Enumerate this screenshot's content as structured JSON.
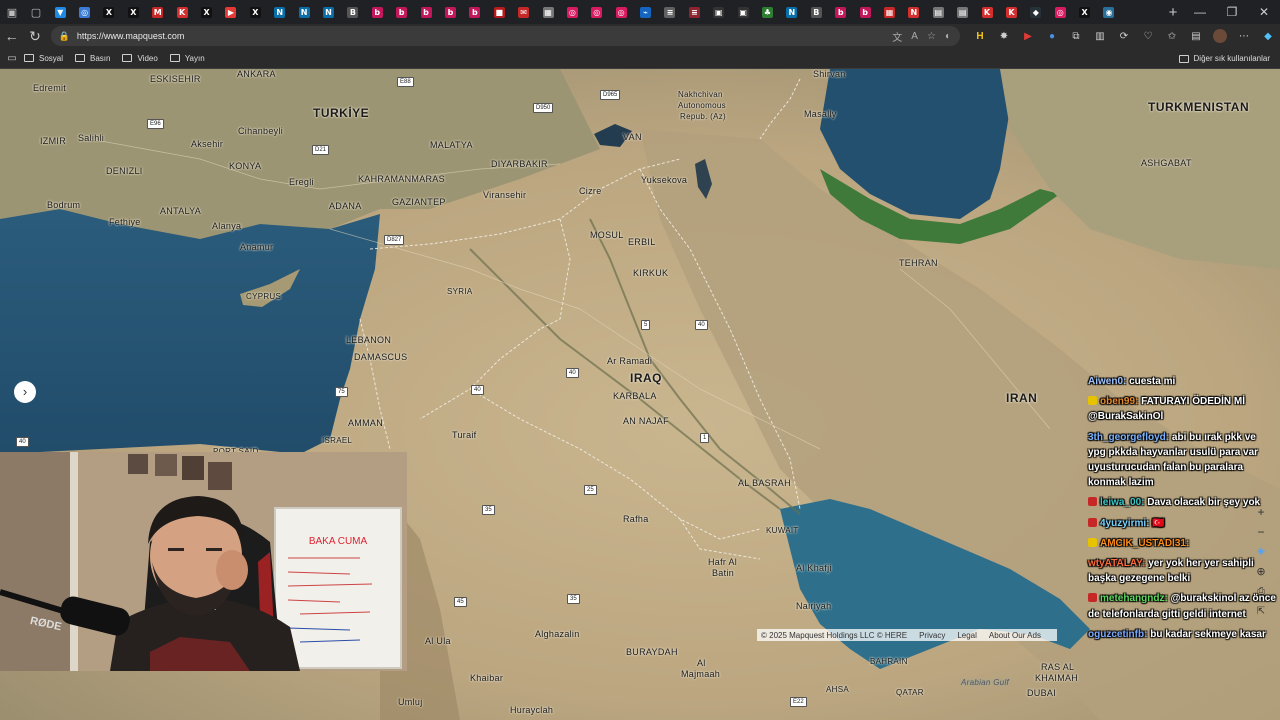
{
  "browser": {
    "url": "https://www.mapquest.com",
    "tab_favicons": [
      {
        "icon": "azure-icon",
        "color": "#1e88e5",
        "glyph": "▼"
      },
      {
        "icon": "edge-icon",
        "color": "#3a7bd5",
        "glyph": "◎"
      },
      {
        "icon": "x-icon",
        "color": "#111111",
        "glyph": "X"
      },
      {
        "icon": "x-icon",
        "color": "#111111",
        "glyph": "X"
      },
      {
        "icon": "gmail-icon",
        "color": "#c62828",
        "glyph": "M"
      },
      {
        "icon": "k-icon",
        "color": "#d32f2f",
        "glyph": "K"
      },
      {
        "icon": "x-icon",
        "color": "#111111",
        "glyph": "X"
      },
      {
        "icon": "youtube-icon",
        "color": "#e53935",
        "glyph": "▶"
      },
      {
        "icon": "x-icon",
        "color": "#111111",
        "glyph": "X"
      },
      {
        "icon": "news-icon",
        "color": "#0b6ea8",
        "glyph": "N"
      },
      {
        "icon": "news-icon",
        "color": "#0b6ea8",
        "glyph": "N"
      },
      {
        "icon": "news-icon",
        "color": "#0b6ea8",
        "glyph": "N"
      },
      {
        "icon": "b-icon",
        "color": "#555555",
        "glyph": "B"
      },
      {
        "icon": "b-icon",
        "color": "#c2185b",
        "glyph": "b"
      },
      {
        "icon": "b-icon",
        "color": "#c2185b",
        "glyph": "b"
      },
      {
        "icon": "b-icon",
        "color": "#c2185b",
        "glyph": "b"
      },
      {
        "icon": "b-icon",
        "color": "#c2185b",
        "glyph": "b"
      },
      {
        "icon": "b-icon",
        "color": "#c2185b",
        "glyph": "b"
      },
      {
        "icon": "red-icon",
        "color": "#b71c1c",
        "glyph": "■"
      },
      {
        "icon": "mail-icon",
        "color": "#c62828",
        "glyph": "✉"
      },
      {
        "icon": "grid-icon",
        "color": "#777777",
        "glyph": "▦"
      },
      {
        "icon": "instagram-icon",
        "color": "#d81b60",
        "glyph": "◎"
      },
      {
        "icon": "instagram-icon",
        "color": "#d81b60",
        "glyph": "◎"
      },
      {
        "icon": "instagram-icon",
        "color": "#d81b60",
        "glyph": "◎"
      },
      {
        "icon": "chart-icon",
        "color": "#1565c0",
        "glyph": "⌁"
      },
      {
        "icon": "dash-icon",
        "color": "#616161",
        "glyph": "≡"
      },
      {
        "icon": "dash-icon",
        "color": "#8e2430",
        "glyph": "≡"
      },
      {
        "icon": "tv-icon",
        "color": "#333333",
        "glyph": "▣"
      },
      {
        "icon": "tv-icon",
        "color": "#333333",
        "glyph": "▣"
      },
      {
        "icon": "leaf-icon",
        "color": "#2e7d32",
        "glyph": "♣"
      },
      {
        "icon": "news-icon",
        "color": "#0b6ea8",
        "glyph": "N"
      },
      {
        "icon": "b-icon",
        "color": "#555555",
        "glyph": "B"
      },
      {
        "icon": "b-icon",
        "color": "#c2185b",
        "glyph": "b"
      },
      {
        "icon": "b-icon",
        "color": "#c2185b",
        "glyph": "b"
      },
      {
        "icon": "grid-icon",
        "color": "#c62828",
        "glyph": "▦"
      },
      {
        "icon": "n-icon",
        "color": "#d32f2f",
        "glyph": "N"
      },
      {
        "icon": "doc-icon",
        "color": "#777777",
        "glyph": "▤"
      },
      {
        "icon": "doc-icon",
        "color": "#777777",
        "glyph": "▤"
      },
      {
        "icon": "k-icon",
        "color": "#d32f2f",
        "glyph": "K"
      },
      {
        "icon": "k-icon",
        "color": "#d32f2f",
        "glyph": "K"
      },
      {
        "icon": "dark-icon",
        "color": "#263238",
        "glyph": "◆"
      },
      {
        "icon": "instagram-icon",
        "color": "#d81b60",
        "glyph": "◎"
      },
      {
        "icon": "x-icon",
        "color": "#111111",
        "glyph": "X"
      },
      {
        "icon": "mapquest-icon",
        "color": "#2a6f97",
        "glyph": "◉"
      }
    ],
    "bookmarks": [
      {
        "label": "Sosyal"
      },
      {
        "label": "Basın"
      },
      {
        "label": "Video"
      },
      {
        "label": "Yayın"
      }
    ],
    "other_bookmarks": "Diğer sık kullanılanlar"
  },
  "map": {
    "country_labels": [
      {
        "text": "TURKİYE"
      },
      {
        "text": "TURKMENISTAN"
      },
      {
        "text": "IRAQ"
      },
      {
        "text": "IRAN"
      }
    ],
    "place_labels": [
      {
        "text": "ANKARA"
      },
      {
        "text": "ESKISEHIR"
      },
      {
        "text": "Edremit"
      },
      {
        "text": "IZMIR"
      },
      {
        "text": "Salihli"
      },
      {
        "text": "DENIZLI"
      },
      {
        "text": "Bodrum"
      },
      {
        "text": "Fethiye"
      },
      {
        "text": "ANTALYA"
      },
      {
        "text": "Alanya"
      },
      {
        "text": "Anamur"
      },
      {
        "text": "KONYA"
      },
      {
        "text": "Aksehir"
      },
      {
        "text": "Cihanbeyli"
      },
      {
        "text": "Eregli"
      },
      {
        "text": "MALATYA"
      },
      {
        "text": "KAHRAMANMARAS"
      },
      {
        "text": "ADANA"
      },
      {
        "text": "GAZIANTEP"
      },
      {
        "text": "DIYARBAKIR"
      },
      {
        "text": "Viransehir"
      },
      {
        "text": "Cizre"
      },
      {
        "text": "VAN"
      },
      {
        "text": "Yuksekova"
      },
      {
        "text": "Nakhchivan"
      },
      {
        "text": "Autonomous"
      },
      {
        "text": "Repub. (Az)"
      },
      {
        "text": "Masally"
      },
      {
        "text": "Shirvan"
      },
      {
        "text": "ASHGABAT"
      },
      {
        "text": "MOSUL"
      },
      {
        "text": "ERBIL"
      },
      {
        "text": "KIRKUK"
      },
      {
        "text": "TEHRAN"
      },
      {
        "text": "SYRIA"
      },
      {
        "text": "CYPRUS"
      },
      {
        "text": "LEBANON"
      },
      {
        "text": "DAMASCUS"
      },
      {
        "text": "Ar Ramadi"
      },
      {
        "text": "KARBALA"
      },
      {
        "text": "AN NAJAF"
      },
      {
        "text": "AMMAN"
      },
      {
        "text": "ISRAEL"
      },
      {
        "text": "PORT SAID"
      },
      {
        "text": "Turaif"
      },
      {
        "text": "AL BASRAH"
      },
      {
        "text": "KUWAIT"
      },
      {
        "text": "Rafha"
      },
      {
        "text": "Hafr Al"
      },
      {
        "text": "Batin"
      },
      {
        "text": "Al Khafji"
      },
      {
        "text": "Nairiyah"
      },
      {
        "text": "Alghazalin"
      },
      {
        "text": "BURAYDAH"
      },
      {
        "text": "Al"
      },
      {
        "text": "Majmaah"
      },
      {
        "text": "Al Ula"
      },
      {
        "text": "Khaibar"
      },
      {
        "text": "Umluj"
      },
      {
        "text": "Hurayclah"
      },
      {
        "text": "BAHRAIN"
      },
      {
        "text": "AHSA"
      },
      {
        "text": "QATAR"
      },
      {
        "text": "RAS AL"
      },
      {
        "text": "KHAIMAH"
      },
      {
        "text": "DUBAI"
      },
      {
        "text": "Arabian Gulf"
      }
    ],
    "route_shields": [
      "E88",
      "D950",
      "D965",
      "E96",
      "D21",
      "D827",
      "5",
      "40",
      "40",
      "75",
      "40",
      "1",
      "25",
      "35",
      "45",
      "35",
      "40",
      "E22"
    ],
    "attribution": {
      "copyright": "© 2025 Mapquest Holdings LLC © HERE",
      "privacy": "Privacy",
      "legal": "Legal",
      "about_ads": "About Our Ads"
    }
  },
  "webcam": {
    "mic_brand": "RØDE",
    "whiteboard_title": "BAKA CUMA"
  },
  "chat": {
    "messages": [
      {
        "user": "Aiwen0:",
        "text": "cuesta mi",
        "user_color": "#9fc4ff",
        "badge": ""
      },
      {
        "user": "oben99:",
        "text": "FATURAYI ÖDEDİN Mİ @BurakSakinOl",
        "user_color": "#e58a2c",
        "badge": "#e6c200"
      },
      {
        "user": "3th_georgefloyd:",
        "text": "abi bu ırak pkk ve ypg pkkda hayvanlar usulü para var uyusturucudan falan bu paralara konmak lazim",
        "user_color": "#7ab3ff",
        "badge": ""
      },
      {
        "user": "leiwa_00:",
        "text": "Dava olacak bir şey yok",
        "user_color": "#37c8c8",
        "badge": "#c62828"
      },
      {
        "user": "4yuzyirmi:",
        "text": "🇹🇷",
        "user_color": "#7ad3ff",
        "badge": "#c62828"
      },
      {
        "user": "AMCIK_USTADI31:",
        "text": "",
        "user_color": "#ff8c1a",
        "badge": "#e6c200"
      },
      {
        "user": "wtyATALAY:",
        "text": "yer yok her yer sahipli başka gezegene belki",
        "user_color": "#ff6a3d",
        "badge": ""
      },
      {
        "user": "metehangndz:",
        "text": "@burakskinol az önce de telefonlarda gitti geldi internet",
        "user_color": "#5fd95f",
        "badge": "#c62828"
      },
      {
        "user": "oguzcetinfb:",
        "text": "bu kadar sekmeye kasar",
        "user_color": "#7aa9ff",
        "badge": ""
      }
    ]
  }
}
